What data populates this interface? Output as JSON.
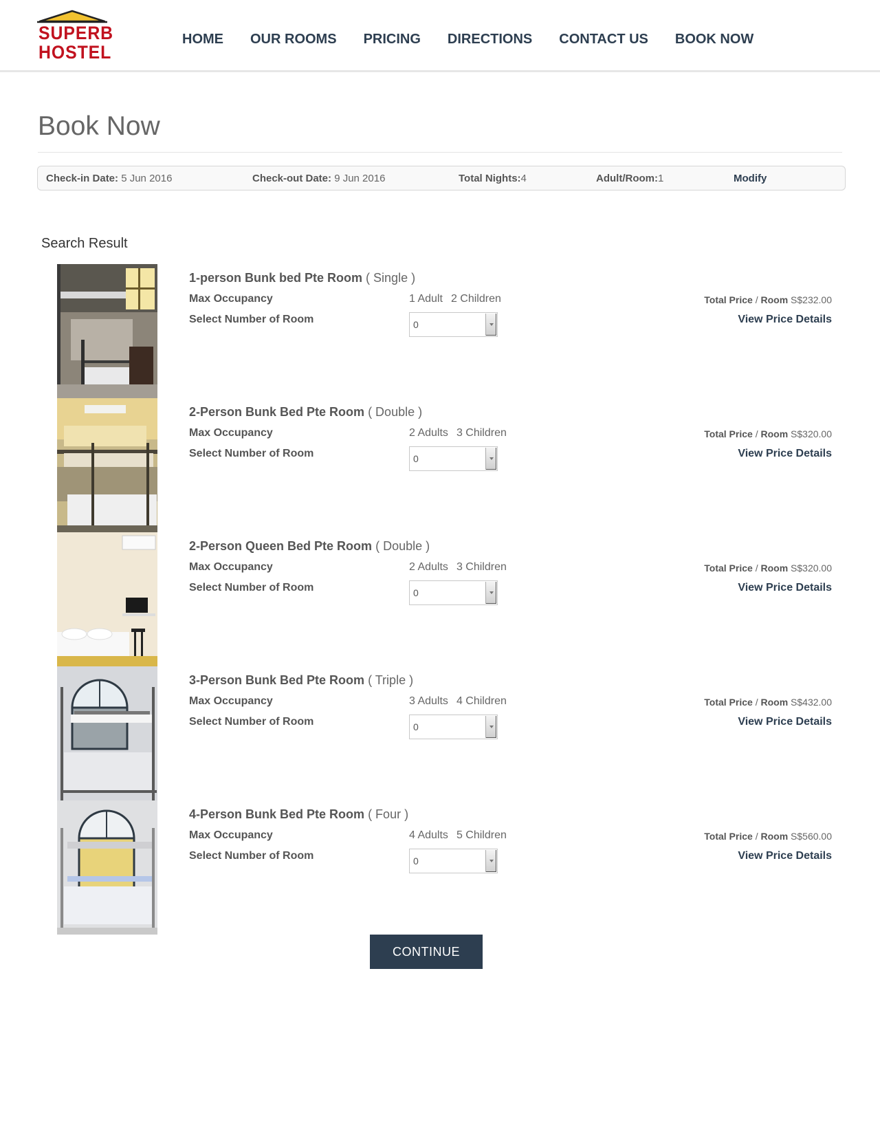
{
  "logo": {
    "line1": "SUPERB",
    "line2": "HOSTEL"
  },
  "nav": [
    "HOME",
    "OUR ROOMS",
    "PRICING",
    "DIRECTIONS",
    "CONTACT US",
    "BOOK NOW"
  ],
  "page_title": "Book Now",
  "summary": {
    "checkin_label": "Check-in Date:",
    "checkin_value": "5 Jun 2016",
    "checkout_label": "Check-out Date:",
    "checkout_value": "9 Jun 2016",
    "nights_label": "Total Nights:",
    "nights_value": "4",
    "adult_label": "Adult/Room:",
    "adult_value": "1",
    "modify": "Modify"
  },
  "search_title": "Search Result",
  "labels": {
    "max_occupancy": "Max Occupancy",
    "select_rooms": "Select Number of Room",
    "total_price": "Total Price",
    "per_room": "Room",
    "view_details": "View Price Details"
  },
  "rooms": [
    {
      "name": "1-person Bunk bed Pte Room",
      "type": "( Single )",
      "adults": "1 Adult",
      "children": "2 Children",
      "selected": "0",
      "price": "S$232.00",
      "photo": "bunk-single"
    },
    {
      "name": "2-Person Bunk Bed Pte Room",
      "type": "( Double )",
      "adults": "2 Adults",
      "children": "3 Children",
      "selected": "0",
      "price": "S$320.00",
      "photo": "bunk-double"
    },
    {
      "name": "2-Person Queen Bed Pte Room",
      "type": "( Double )",
      "adults": "2 Adults",
      "children": "3 Children",
      "selected": "0",
      "price": "S$320.00",
      "photo": "queen-bed"
    },
    {
      "name": "3-Person Bunk Bed Pte Room",
      "type": "( Triple )",
      "adults": "3 Adults",
      "children": "4 Children",
      "selected": "0",
      "price": "S$432.00",
      "photo": "bunk-triple"
    },
    {
      "name": "4-Person Bunk Bed Pte Room",
      "type": "( Four )",
      "adults": "4 Adults",
      "children": "5 Children",
      "selected": "0",
      "price": "S$560.00",
      "photo": "bunk-four"
    }
  ],
  "continue_label": "CONTINUE",
  "colors": {
    "brand_red": "#c1121f",
    "navy": "#2d3e50",
    "roof_yellow": "#f2c230"
  }
}
